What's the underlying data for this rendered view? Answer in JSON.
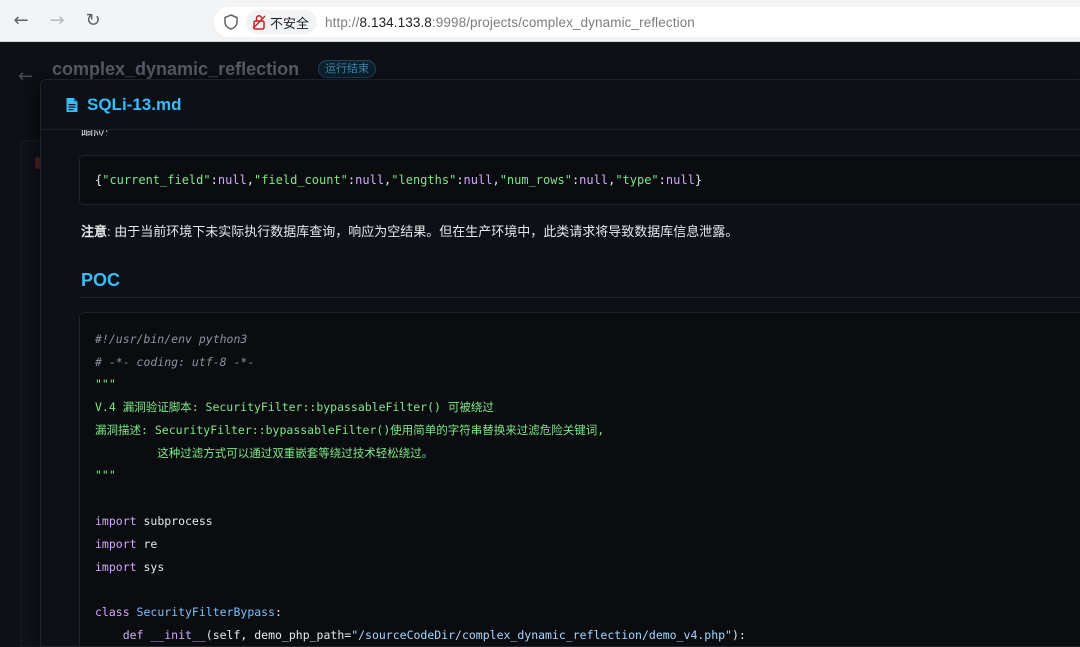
{
  "browser": {
    "back_icon": "←",
    "forward_icon": "→",
    "reload_icon": "↻",
    "insecure_label": "不安全",
    "url_scheme": "http://",
    "url_host": "8.134.133.8",
    "url_rest": ":9998/projects/complex_dynamic_reflection"
  },
  "page": {
    "back_icon": "←",
    "project_title": "complex_dynamic_reflection",
    "status": "运行结束"
  },
  "modal": {
    "title": "SQLi-13.md",
    "cut_label": "响应:",
    "json_response": {
      "key1": "\"current_field\"",
      "val1": "null",
      "key2": "\"field_count\"",
      "val2": "null",
      "key3": "\"lengths\"",
      "val3": "null",
      "key4": "\"num_rows\"",
      "val4": "null",
      "key5": "\"type\"",
      "val5": "null"
    },
    "note_label": "注意",
    "note_text": ": 由于当前环境下未实际执行数据库查询，响应为空结果。但在生产环境中，此类请求将导致数据库信息泄露。",
    "section_title": "POC",
    "code": {
      "l1": "#!/usr/bin/env python3",
      "l2": "# -*- coding: utf-8 -*-",
      "l3": "\"\"\"",
      "l4": "V.4 漏洞验证脚本: SecurityFilter::bypassableFilter() 可被绕过",
      "l5": "漏洞描述: SecurityFilter::bypassableFilter()使用简单的字符串替换来过滤危险关键词,",
      "l6": "         这种过滤方式可以通过双重嵌套等绕过技术轻松绕过。",
      "l7": "\"\"\"",
      "l9_kw": "import",
      "l9": " subprocess",
      "l10_kw": "import",
      "l10": " re",
      "l11_kw": "import",
      "l11": " sys",
      "l13_kw": "class",
      "l13_name": " SecurityFilterBypass",
      "l13_end": ":",
      "l14_kw": "    def",
      "l14_name": " __init__",
      "l14_args": "(self, demo_php_path=",
      "l14_str": "\"/sourceCodeDir/complex_dynamic_reflection/demo_v4.php\"",
      "l14_end": "):"
    }
  }
}
